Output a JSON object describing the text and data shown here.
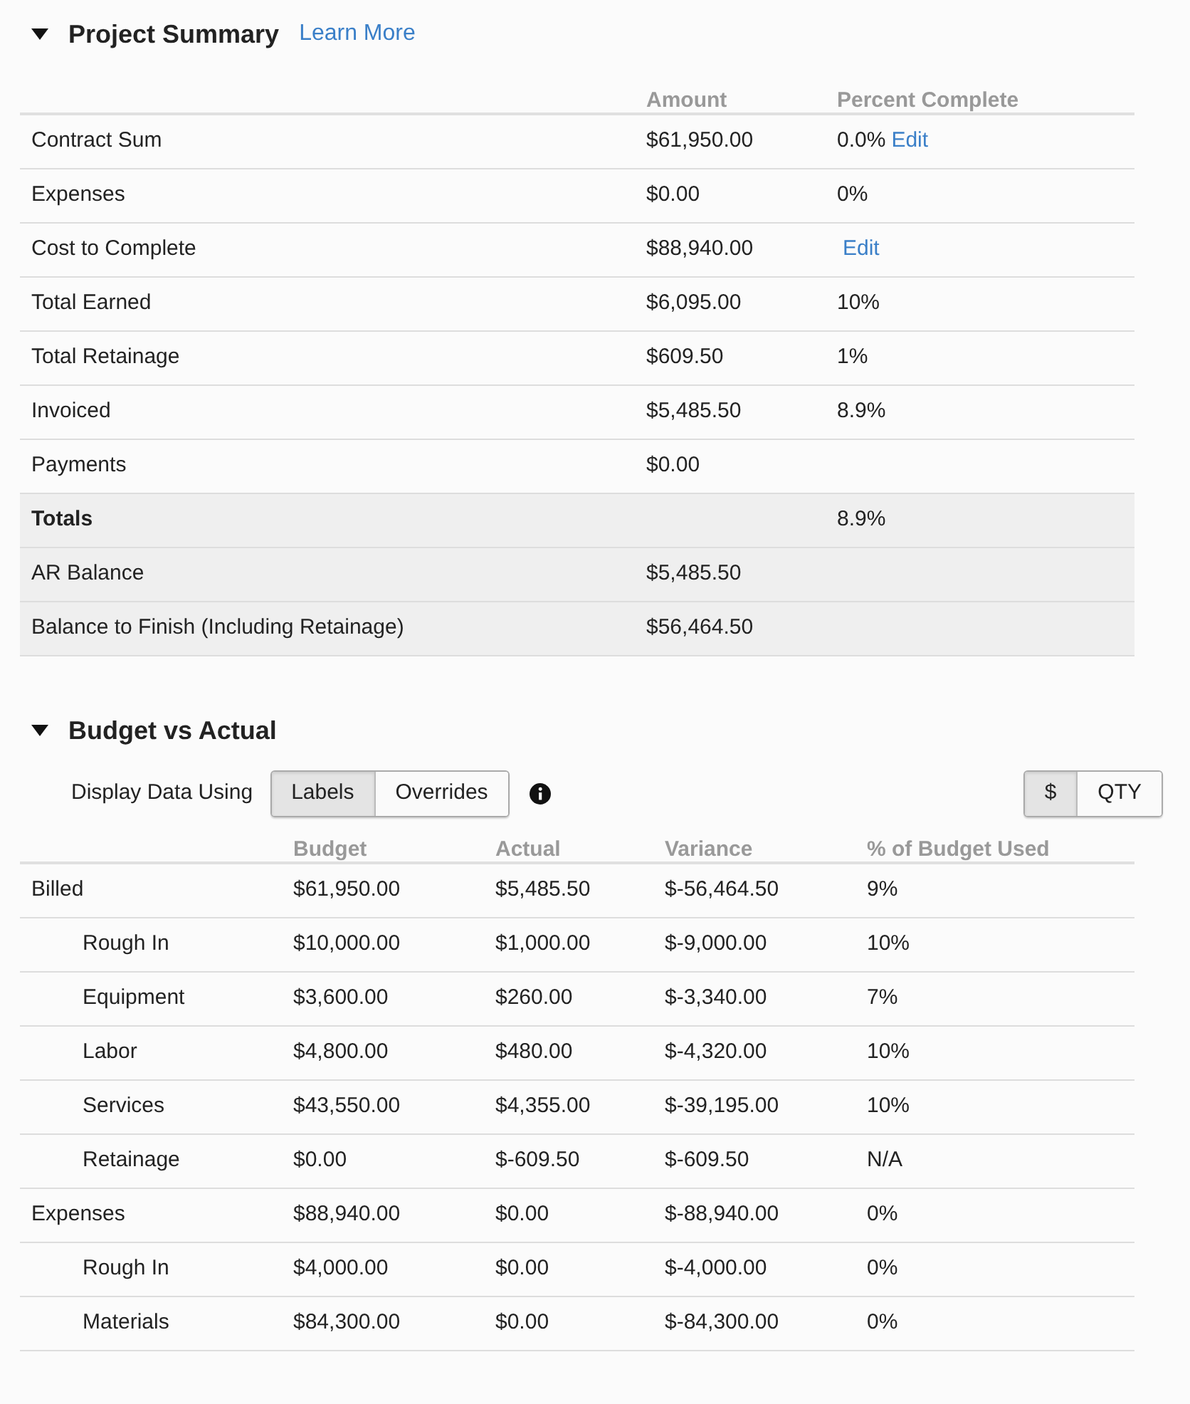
{
  "project_summary": {
    "title": "Project Summary",
    "expanded": true,
    "learn_more": "Learn More",
    "columns": [
      "Amount",
      "Percent Complete"
    ],
    "rows": [
      {
        "kind": "normal",
        "label": "Contract Sum",
        "amount": "$61,950.00",
        "percent": "0.0%",
        "edit": "Edit"
      },
      {
        "kind": "normal",
        "label": "Expenses",
        "amount": "$0.00",
        "percent": "0%"
      },
      {
        "kind": "normal",
        "label": "Cost to Complete",
        "amount": "$88,940.00",
        "edit": "Edit"
      },
      {
        "kind": "normal",
        "label": "Total Earned",
        "amount": "$6,095.00",
        "percent": "10%"
      },
      {
        "kind": "normal",
        "label": "Total Retainage",
        "amount": "$609.50",
        "percent": "1%"
      },
      {
        "kind": "normal",
        "label": "Invoiced",
        "amount": "$5,485.50",
        "percent": "8.9%"
      },
      {
        "kind": "normal",
        "label": "Payments",
        "amount": "$0.00"
      },
      {
        "kind": "total",
        "label": "Totals",
        "percent": "8.9%"
      },
      {
        "kind": "summary",
        "label": "AR Balance",
        "amount": "$5,485.50"
      },
      {
        "kind": "summary",
        "label": "Balance to Finish (Including Retainage)",
        "amount": "$56,464.50"
      }
    ]
  },
  "budget_vs_actual": {
    "title": "Budget vs Actual",
    "expanded": true,
    "display_label": "Display Data Using",
    "display_options": [
      {
        "label": "Labels",
        "selected": true
      },
      {
        "label": "Overrides",
        "selected": false
      }
    ],
    "unit_options": [
      {
        "label": "$",
        "selected": true
      },
      {
        "label": "QTY",
        "selected": false
      }
    ],
    "columns": [
      "Budget",
      "Actual",
      "Variance",
      "% of Budget Used"
    ],
    "rows": [
      {
        "label": "Billed",
        "budget": "$61,950.00",
        "actual": "$5,485.50",
        "variance": "$-56,464.50",
        "used": "9%",
        "children": [
          {
            "label": "Rough In",
            "budget": "$10,000.00",
            "actual": "$1,000.00",
            "variance": "$-9,000.00",
            "used": "10%"
          },
          {
            "label": "Equipment",
            "budget": "$3,600.00",
            "actual": "$260.00",
            "variance": "$-3,340.00",
            "used": "7%"
          },
          {
            "label": "Labor",
            "budget": "$4,800.00",
            "actual": "$480.00",
            "variance": "$-4,320.00",
            "used": "10%"
          },
          {
            "label": "Services",
            "budget": "$43,550.00",
            "actual": "$4,355.00",
            "variance": "$-39,195.00",
            "used": "10%"
          },
          {
            "label": "Retainage",
            "budget": "$0.00",
            "actual": "$-609.50",
            "variance": "$-609.50",
            "used": "N/A"
          }
        ]
      },
      {
        "label": "Expenses",
        "budget": "$88,940.00",
        "actual": "$0.00",
        "variance": "$-88,940.00",
        "used": "0%",
        "children": [
          {
            "label": "Rough In",
            "budget": "$4,000.00",
            "actual": "$0.00",
            "variance": "$-4,000.00",
            "used": "0%"
          },
          {
            "label": "Materials",
            "budget": "$84,300.00",
            "actual": "$0.00",
            "variance": "$-84,300.00",
            "used": "0%"
          }
        ]
      }
    ]
  }
}
